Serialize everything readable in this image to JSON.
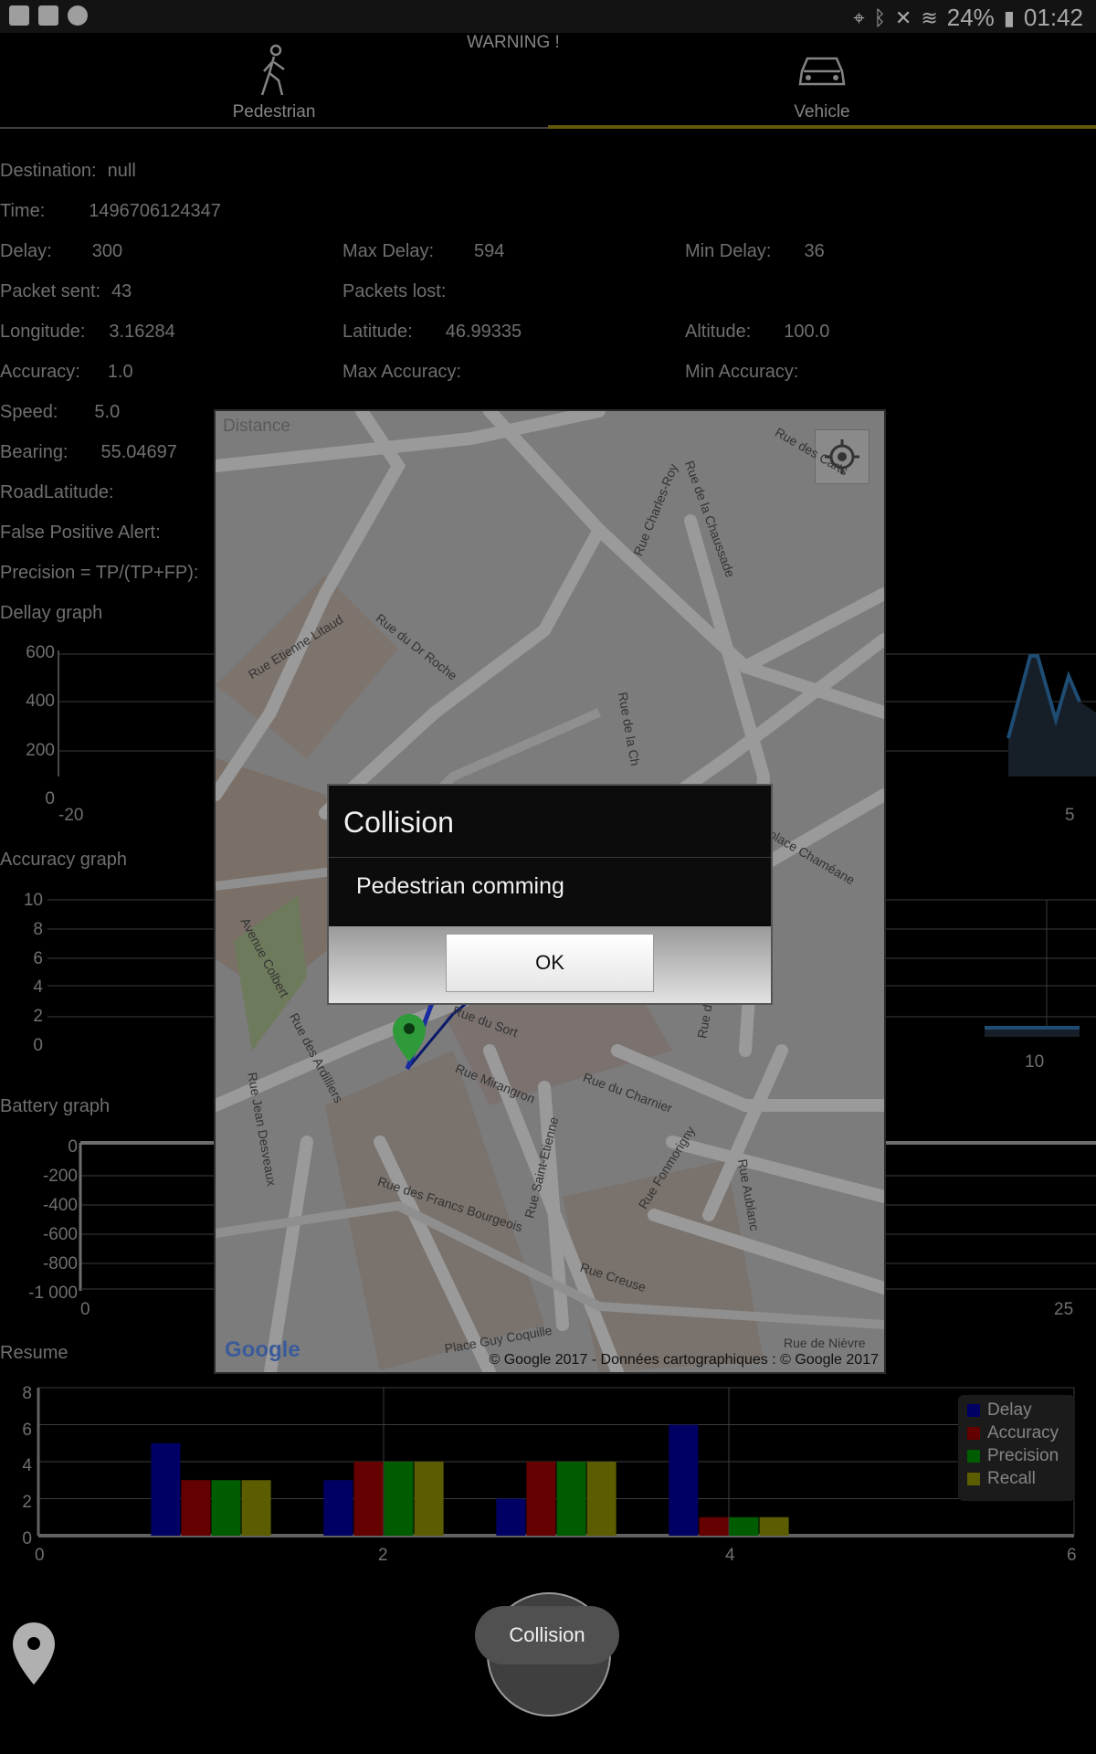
{
  "status_bar": {
    "battery": "24%",
    "time": "01:42"
  },
  "tabs": {
    "pedestrian": "Pedestrian",
    "warning": "WARNING !",
    "vehicle": "Vehicle"
  },
  "info": {
    "destination_label": "Destination:",
    "destination_value": "null",
    "time_label": "Time:",
    "time_value": "1496706124347",
    "delay_label": "Delay:",
    "delay_value": "300",
    "max_delay_label": "Max Delay:",
    "max_delay_value": "594",
    "min_delay_label": "Min Delay:",
    "min_delay_value": "36",
    "packet_sent_label": "Packet sent:",
    "packet_sent_value": "43",
    "packets_lost_label": "Packets lost:",
    "longitude_label": "Longitude:",
    "longitude_value": "3.16284",
    "latitude_label": "Latitude:",
    "latitude_value": "46.99335",
    "altitude_label": "Altitude:",
    "altitude_value": "100.0",
    "accuracy_label": "Accuracy:",
    "accuracy_value": "1.0",
    "max_accuracy_label": "Max Accuracy:",
    "min_accuracy_label": "Min Accuracy:",
    "speed_label": "Speed:",
    "speed_value": "5.0",
    "bearing_label": "Bearing:",
    "bearing_value": "55.04697",
    "road_latitude_label": "RoadLatitude:",
    "false_positive_label": "False Positive Alert:",
    "precision_label": "Precision = TP/(TP+FP):",
    "distance_label": "Distance"
  },
  "graphs": {
    "delay_title": "Dellay graph",
    "accuracy_title": "Accuracy graph",
    "battery_title": "Battery graph",
    "resume_title": "Resume",
    "delay_yticks": [
      "600",
      "400",
      "200",
      "0"
    ],
    "delay_x_left": "-20",
    "delay_x_right": "5",
    "accuracy_yticks": [
      "10",
      "8",
      "6",
      "4",
      "2",
      "0"
    ],
    "accuracy_x_right": "10",
    "battery_yticks": [
      "0",
      "-200",
      "-400",
      "-600",
      "-800",
      "-1 000"
    ],
    "battery_x_left": "0",
    "battery_x_right": "25",
    "resume_yticks": [
      "8",
      "6",
      "4",
      "2",
      "0"
    ],
    "resume_xticks": [
      "0",
      "2",
      "4",
      "6"
    ]
  },
  "chart_data": {
    "type": "bar",
    "categories": [
      "1",
      "2",
      "3",
      "4"
    ],
    "series": [
      {
        "name": "Delay",
        "values": [
          5,
          3,
          2,
          6
        ],
        "color": "#00008b"
      },
      {
        "name": "Accuracy",
        "values": [
          3,
          4,
          4,
          1
        ],
        "color": "#8b0000"
      },
      {
        "name": "Precision",
        "values": [
          3,
          4,
          4,
          1
        ],
        "color": "#008000"
      },
      {
        "name": "Recall",
        "values": [
          3,
          4,
          4,
          1
        ],
        "color": "#808000"
      }
    ],
    "xlim": [
      0,
      6
    ],
    "ylim": [
      0,
      8
    ],
    "legend": "top-right"
  },
  "map": {
    "copyright": "© Google 2017 - Données cartographiques : © Google 2017",
    "google_logo": "Google",
    "streets": [
      "Rue Charles-Roy",
      "Rue de la Chaussade",
      "Rue Etienne Litaud",
      "Rue du Dr Roche",
      "Rue de la Ch",
      "place Chaméane",
      "Avenue Colbert",
      "Rue du Sort",
      "Rue Mirangron",
      "Rue du Charnier",
      "Rue du Clou",
      "Rue des Ardilliers",
      "Rue Jean Desveaux",
      "Rue des Francs Bourgeois",
      "Rue Saint-Etienne",
      "Rue Fonmorigny",
      "Rue Aublanc",
      "Rue Creuse",
      "Place Guy Coquille",
      "Rue de Nièvre",
      "Rue des Carts"
    ]
  },
  "dialog": {
    "title": "Collision",
    "message": "Pedestrian comming",
    "ok_label": "OK"
  },
  "fab": {
    "label": "Collision"
  }
}
